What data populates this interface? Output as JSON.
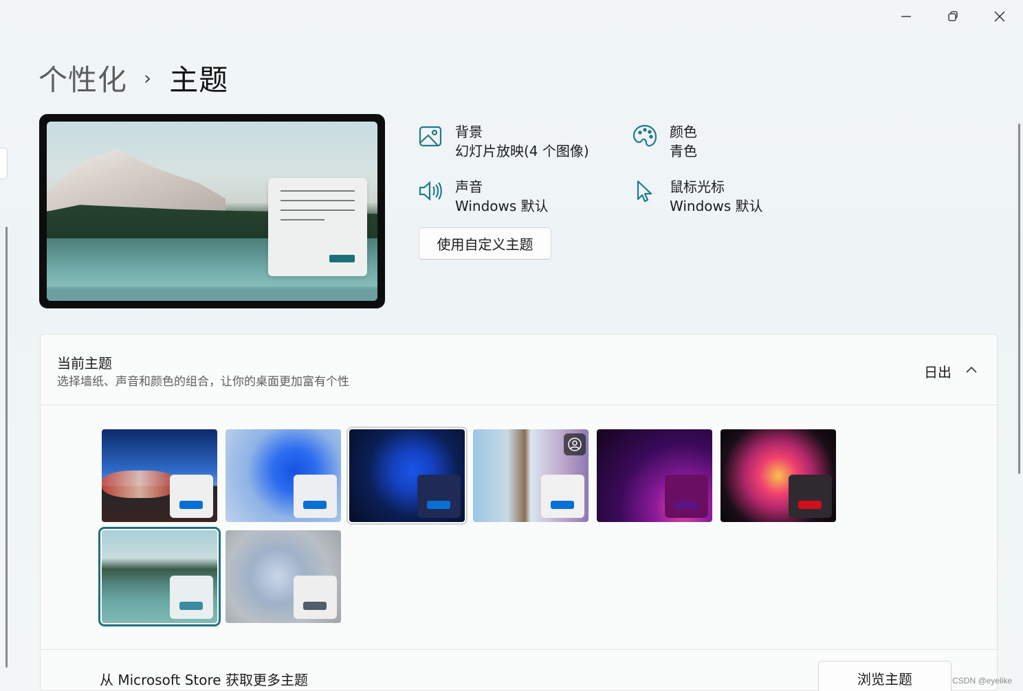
{
  "window_controls": {
    "minimize": "minimize-icon",
    "restore": "restore-icon",
    "close": "close-icon"
  },
  "breadcrumb": {
    "parent": "个性化",
    "separator": "›",
    "current": "主题"
  },
  "theme_info": {
    "background": {
      "label": "背景",
      "value": "幻灯片放映(4 个图像)",
      "icon": "image-icon"
    },
    "color": {
      "label": "颜色",
      "value": "青色",
      "icon": "palette-icon"
    },
    "sound": {
      "label": "声音",
      "value": "Windows 默认",
      "icon": "speaker-icon"
    },
    "cursor": {
      "label": "鼠标光标",
      "value": "Windows 默认",
      "icon": "cursor-icon"
    },
    "custom_button": "使用自定义主题"
  },
  "current_theme": {
    "title": "当前主题",
    "subtitle": "选择墙纸、声音和颜色的组合，让你的桌面更加富有个性",
    "value": "日出",
    "themes": [
      {
        "name": "theme-sunrise-lights",
        "accent": "#0a6fd3",
        "mini_bg": "#efefef",
        "selected": false
      },
      {
        "name": "theme-windows-light",
        "accent": "#0a6fd3",
        "mini_bg": "#eceef2",
        "selected": false
      },
      {
        "name": "theme-windows-dark",
        "accent": "#0a6fd3",
        "mini_bg": "#1f2a56",
        "selected": false
      },
      {
        "name": "theme-spotlight",
        "accent": "#0a6fd3",
        "mini_bg": "#f1f1f1",
        "selected": false
      },
      {
        "name": "theme-glow",
        "accent": "#5a1480",
        "mini_bg": "#6a0e64",
        "selected": false
      },
      {
        "name": "theme-captured-motion",
        "accent": "#d00e1e",
        "mini_bg": "#2e2a2f",
        "selected": false
      },
      {
        "name": "theme-sunrise",
        "accent": "#3a8ca0",
        "mini_bg": "#e9eeee",
        "selected": true
      },
      {
        "name": "theme-flow",
        "accent": "#505d6a",
        "mini_bg": "#eeeeee",
        "selected": false
      }
    ]
  },
  "store": {
    "label": "从 Microsoft Store 获取更多主题",
    "button": "浏览主题"
  },
  "watermark": "CSDN @eyelike",
  "colors": {
    "accent": "#1f7a8a"
  }
}
